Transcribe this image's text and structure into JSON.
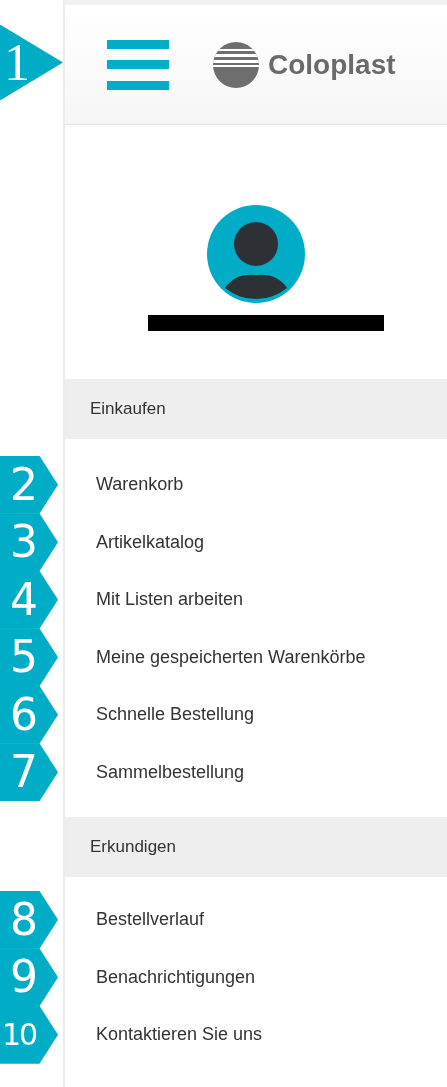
{
  "header": {
    "marker": "1",
    "logo_text": "Coloplast"
  },
  "sections": [
    {
      "title": "Einkaufen",
      "items": [
        {
          "label": "Warenkorb",
          "marker": "2"
        },
        {
          "label": "Artikelkatalog",
          "marker": "3"
        },
        {
          "label": "Mit Listen arbeiten",
          "marker": "4"
        },
        {
          "label": "Meine gespeicherten Warenkörbe",
          "marker": "5"
        },
        {
          "label": "Schnelle Bestellung",
          "marker": "6"
        },
        {
          "label": "Sammelbestellung",
          "marker": "7"
        }
      ]
    },
    {
      "title": "Erkundigen",
      "items": [
        {
          "label": "Bestellverlauf",
          "marker": "8"
        },
        {
          "label": "Benachrichtigungen",
          "marker": "9"
        },
        {
          "label": "Kontaktieren Sie uns",
          "marker": "10"
        }
      ]
    }
  ]
}
